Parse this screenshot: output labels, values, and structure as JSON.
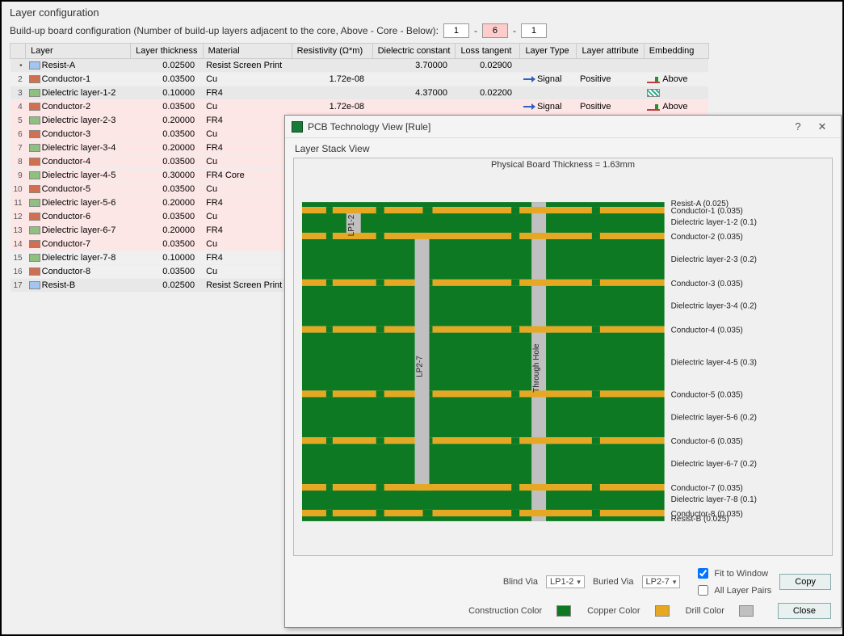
{
  "title": "Layer configuration",
  "config_label": "Build-up board configuration (Number of build-up layers adjacent to the core, Above - Core - Below):",
  "above": "1",
  "core": "6",
  "below": "1",
  "dash": "-",
  "headers": {
    "layer": "Layer",
    "thickness": "Layer thickness",
    "material": "Material",
    "resistivity": "Resistivity (Ω*m)",
    "dielectric": "Dielectric constant",
    "loss": "Loss tangent",
    "type": "Layer Type",
    "attribute": "Layer attribute",
    "embedding": "Embedding"
  },
  "rows": [
    {
      "n": "•",
      "icon": "blue",
      "name": "Resist-A",
      "th": "0.02500",
      "mat": "Resist Screen Print",
      "res": "",
      "dc": "3.70000",
      "lt": "0.02900",
      "type": "",
      "attr": "",
      "emb": "",
      "cls": "grey"
    },
    {
      "n": "2",
      "icon": "red",
      "name": "Conductor-1",
      "th": "0.03500",
      "mat": "Cu",
      "res": "1.72e-08",
      "dc": "",
      "lt": "",
      "type": "Signal",
      "typeicon": "sig",
      "attr": "Positive",
      "emb": "Above",
      "embicon": "above",
      "cls": ""
    },
    {
      "n": "3",
      "icon": "green",
      "name": "Dielectric layer-1-2",
      "th": "0.10000",
      "mat": "FR4",
      "res": "",
      "dc": "4.37000",
      "lt": "0.02200",
      "type": "",
      "attr": "",
      "emb": "",
      "embicon": "hatch",
      "cls": "grey"
    },
    {
      "n": "4",
      "icon": "red",
      "name": "Conductor-2",
      "th": "0.03500",
      "mat": "Cu",
      "res": "1.72e-08",
      "dc": "",
      "lt": "",
      "type": "Signal",
      "typeicon": "sig",
      "attr": "Positive",
      "emb": "Above",
      "embicon": "above",
      "cls": "pink"
    },
    {
      "n": "5",
      "icon": "green",
      "name": "Dielectric layer-2-3",
      "th": "0.20000",
      "mat": "FR4",
      "cls": "pink"
    },
    {
      "n": "6",
      "icon": "red",
      "name": "Conductor-3",
      "th": "0.03500",
      "mat": "Cu",
      "cls": "pink"
    },
    {
      "n": "7",
      "icon": "green",
      "name": "Dielectric layer-3-4",
      "th": "0.20000",
      "mat": "FR4",
      "cls": "pink"
    },
    {
      "n": "8",
      "icon": "red",
      "name": "Conductor-4",
      "th": "0.03500",
      "mat": "Cu",
      "cls": "pink"
    },
    {
      "n": "9",
      "icon": "green",
      "name": "Dielectric layer-4-5",
      "th": "0.30000",
      "mat": "FR4 Core",
      "cls": "pink"
    },
    {
      "n": "10",
      "icon": "red",
      "name": "Conductor-5",
      "th": "0.03500",
      "mat": "Cu",
      "cls": "pink"
    },
    {
      "n": "11",
      "icon": "green",
      "name": "Dielectric layer-5-6",
      "th": "0.20000",
      "mat": "FR4",
      "cls": "pink"
    },
    {
      "n": "12",
      "icon": "red",
      "name": "Conductor-6",
      "th": "0.03500",
      "mat": "Cu",
      "cls": "pink"
    },
    {
      "n": "13",
      "icon": "green",
      "name": "Dielectric layer-6-7",
      "th": "0.20000",
      "mat": "FR4",
      "cls": "pink"
    },
    {
      "n": "14",
      "icon": "red",
      "name": "Conductor-7",
      "th": "0.03500",
      "mat": "Cu",
      "cls": "pink"
    },
    {
      "n": "15",
      "icon": "green",
      "name": "Dielectric layer-7-8",
      "th": "0.10000",
      "mat": "FR4",
      "cls": ""
    },
    {
      "n": "16",
      "icon": "red",
      "name": "Conductor-8",
      "th": "0.03500",
      "mat": "Cu",
      "cls": ""
    },
    {
      "n": "17",
      "icon": "blue",
      "name": "Resist-B",
      "th": "0.02500",
      "mat": "Resist Screen Print",
      "cls": "grey"
    }
  ],
  "dialog": {
    "title": "PCB Technology View [Rule]",
    "subtitle": "Layer Stack View",
    "board_thickness": "Physical Board Thickness = 1.63mm",
    "labels": [
      "Resist-A (0.025)",
      "Conductor-1 (0.035)",
      "Dielectric layer-1-2 (0.1)",
      "Conductor-2 (0.035)",
      "Dielectric layer-2-3 (0.2)",
      "Conductor-3 (0.035)",
      "Dielectric layer-3-4 (0.2)",
      "Conductor-4 (0.035)",
      "Dielectric layer-4-5 (0.3)",
      "Conductor-5 (0.035)",
      "Dielectric layer-5-6 (0.2)",
      "Conductor-6 (0.035)",
      "Dielectric layer-6-7 (0.2)",
      "Conductor-7 (0.035)",
      "Dielectric layer-7-8 (0.1)",
      "Conductor-8 (0.035)",
      "Resist-B (0.025)"
    ],
    "via1": "LP1-2",
    "via2": "LP2-7",
    "through": "Through Hole",
    "blind_label": "Blind Via",
    "buried_label": "Buried Via",
    "blind_sel": "LP1-2",
    "buried_sel": "LP2-7",
    "fit": "Fit to Window",
    "allpairs": "All Layer Pairs",
    "copy": "Copy",
    "close": "Close",
    "cons_color": "Construction Color",
    "copper_color": "Copper Color",
    "drill_color": "Drill Color",
    "colors": {
      "cons": "#0d7a23",
      "copper": "#e6a823",
      "drill": "#c0c0c0"
    }
  }
}
